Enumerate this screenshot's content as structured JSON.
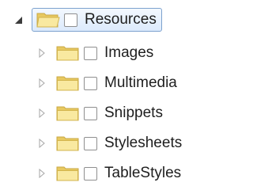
{
  "tree": {
    "root": {
      "label": "Resources",
      "expanded": true,
      "selected": true,
      "checked": false,
      "icon": "folder-open-icon"
    },
    "children": [
      {
        "label": "Images",
        "expanded": false,
        "checked": false,
        "icon": "folder-icon"
      },
      {
        "label": "Multimedia",
        "expanded": false,
        "checked": false,
        "icon": "folder-icon"
      },
      {
        "label": "Snippets",
        "expanded": false,
        "checked": false,
        "icon": "folder-icon"
      },
      {
        "label": "Stylesheets",
        "expanded": false,
        "checked": false,
        "icon": "folder-icon"
      },
      {
        "label": "TableStyles",
        "expanded": false,
        "checked": false,
        "icon": "folder-icon"
      }
    ]
  },
  "colors": {
    "selection_border": "#7da2ce",
    "folder_fill": "#f7e58e",
    "folder_edge": "#d2b44c",
    "expander_collapsed": "#a6a6a6",
    "expander_expanded": "#3c3c3c"
  }
}
